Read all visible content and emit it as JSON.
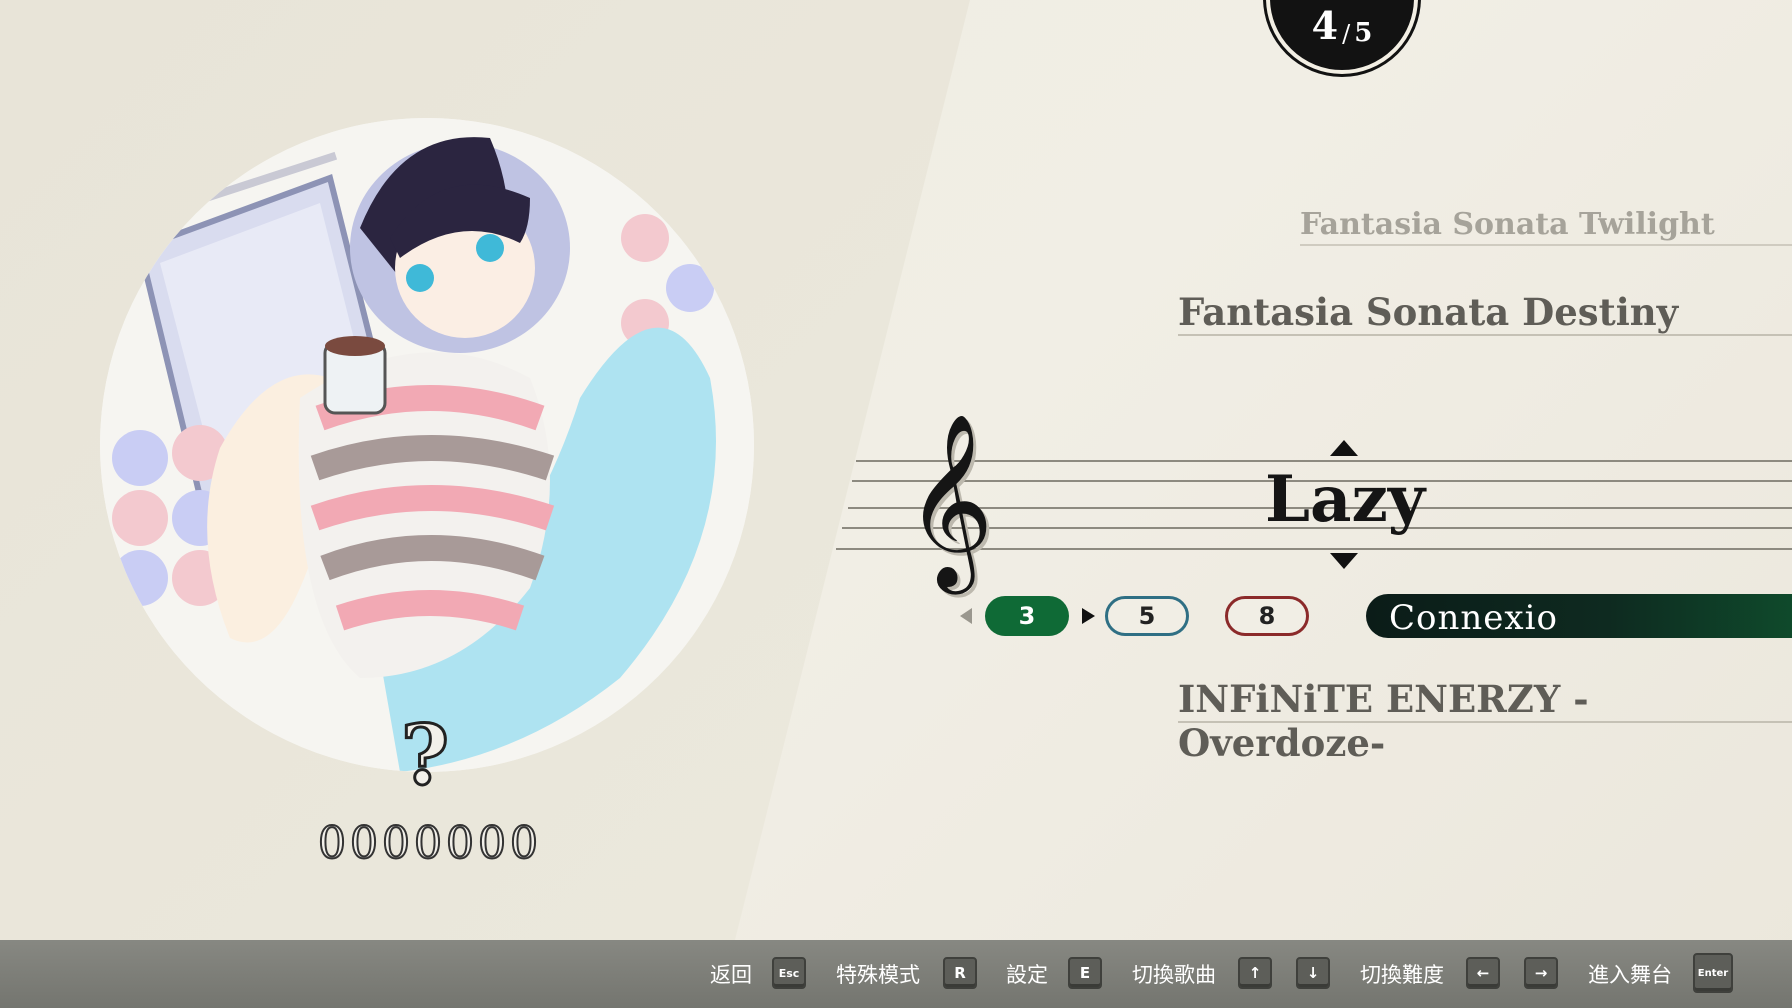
{
  "counter": {
    "current": "4",
    "separator": "/",
    "total": "5"
  },
  "songs": {
    "previous": "Fantasia Sonata Twilight",
    "current": "Fantasia Sonata Destiny",
    "next": "INFiNiTE ENERZY -Overdoze-"
  },
  "difficulty": {
    "name": "Lazy",
    "levels": [
      "3",
      "5",
      "8"
    ],
    "colors": {
      "easy": "#0f6a36",
      "normal": "#2f6f84",
      "hard": "#8b2a2a"
    }
  },
  "composer": "Connexio",
  "result": {
    "grade": "?",
    "score": "0000000"
  },
  "clef": "𝄞",
  "footer": {
    "back_label": "返回",
    "back_key": "Esc",
    "special_label": "特殊模式",
    "special_key": "R",
    "settings_label": "設定",
    "settings_key": "E",
    "switch_song_label": "切換歌曲",
    "switch_song_keys": [
      "↑",
      "↓"
    ],
    "switch_diff_label": "切換難度",
    "switch_diff_keys": [
      "←",
      "→"
    ],
    "enter_label": "進入舞台",
    "enter_key": "Enter"
  }
}
